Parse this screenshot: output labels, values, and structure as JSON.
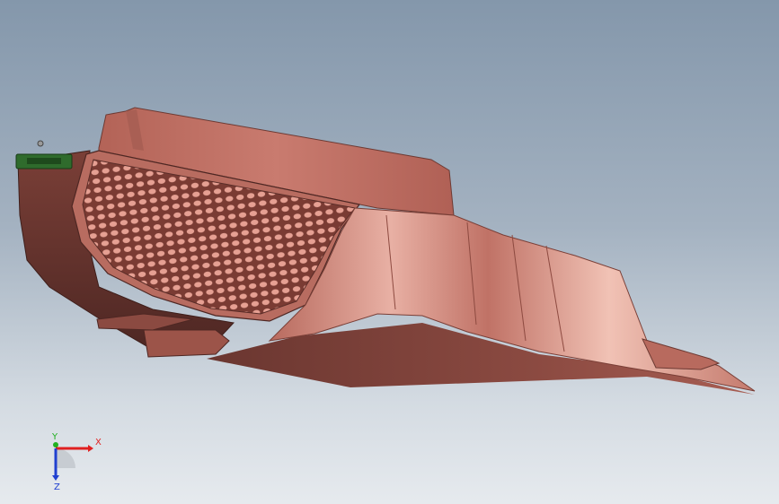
{
  "viewport": {
    "background_top": "#8497ab",
    "background_bottom": "#e6eaee"
  },
  "model": {
    "icon": "cad-part-render",
    "colors": {
      "body_light": "#c97b6f",
      "body_mid": "#a85e53",
      "body_dark": "#6f3a33",
      "body_shadow": "#5a2d28",
      "grille": "#e7a093",
      "highlight": "#f1c2b5",
      "clip_green": "#2f6b2c"
    }
  },
  "triad": {
    "x_label": "X",
    "y_label": "Y",
    "z_label": "Z",
    "x_color": "#e02020",
    "y_color": "#20b020",
    "z_color": "#2040d0"
  }
}
